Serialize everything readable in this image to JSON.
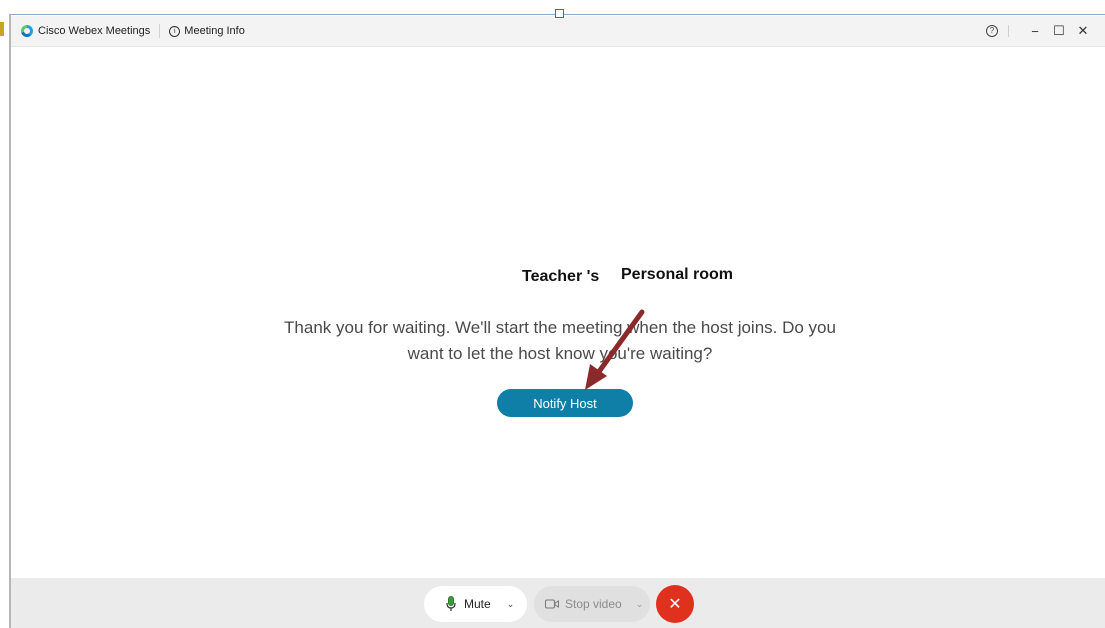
{
  "titlebar": {
    "app_name": "Cisco Webex Meetings",
    "meeting_info": "Meeting Info",
    "help_icon": "question-circle-icon",
    "minimize": "−",
    "maximize": "☐",
    "close": "✕"
  },
  "annotation": {
    "part1": "Teacher 's",
    "part2": "Personal room",
    "arrow_color": "#8b2a2a"
  },
  "main": {
    "message": "Thank you for waiting. We'll start the meeting when the host joins. Do you want to let the host know you're waiting?",
    "notify_button": "Notify Host"
  },
  "controls": {
    "mute_label": "Mute",
    "video_label": "Stop video",
    "leave_icon": "✕"
  },
  "colors": {
    "primary_button": "#0f7fa8",
    "leave_button": "#e0301e",
    "mic_green": "#3a9d3a"
  }
}
